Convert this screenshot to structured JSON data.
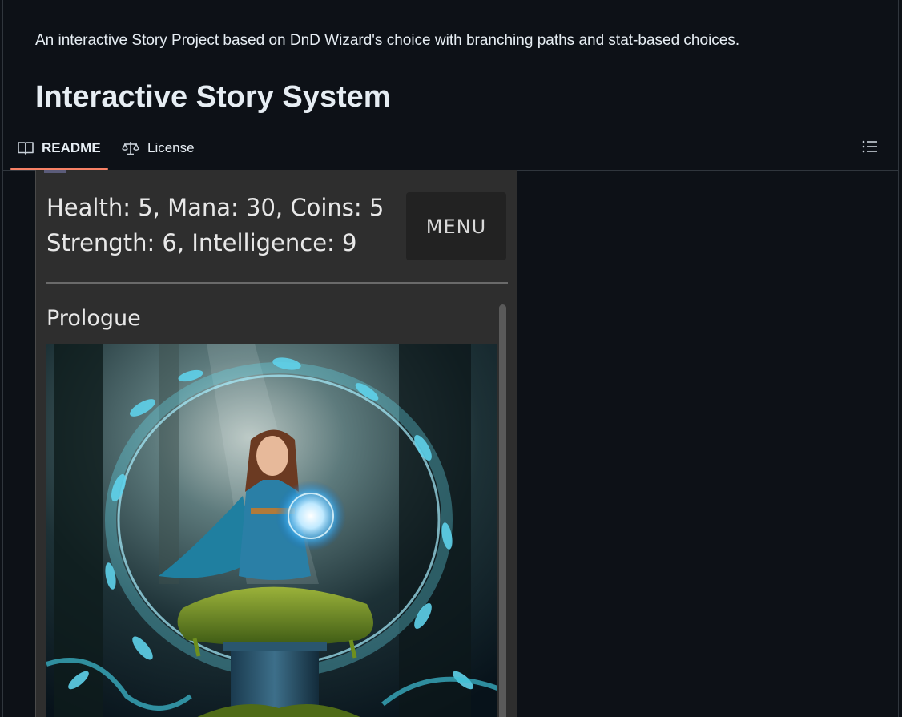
{
  "readme": {
    "description": "An interactive Story Project based on DnD Wizard's choice with branching paths and stat-based choices.",
    "heading": "Interactive Story System"
  },
  "tabs": [
    {
      "label": "README",
      "icon": "book-icon",
      "active": true
    },
    {
      "label": "License",
      "icon": "scale-icon",
      "active": false
    }
  ],
  "outline_icon": "list-icon",
  "game_screenshot": {
    "stats_line1": "Health: 5, Mana: 30, Coins: 5",
    "stats_line2": "Strength: 6, Intelligence: 9",
    "menu_label": "MENU",
    "chapter_title": "Prologue",
    "illustration": "wizard-girl-casting-orb-illustration"
  },
  "colors": {
    "page_bg": "#0d1117",
    "text": "#e6edf3",
    "active_tab_underline": "#f78166",
    "game_bg": "#2e2e2e",
    "menu_bg": "#222222"
  }
}
